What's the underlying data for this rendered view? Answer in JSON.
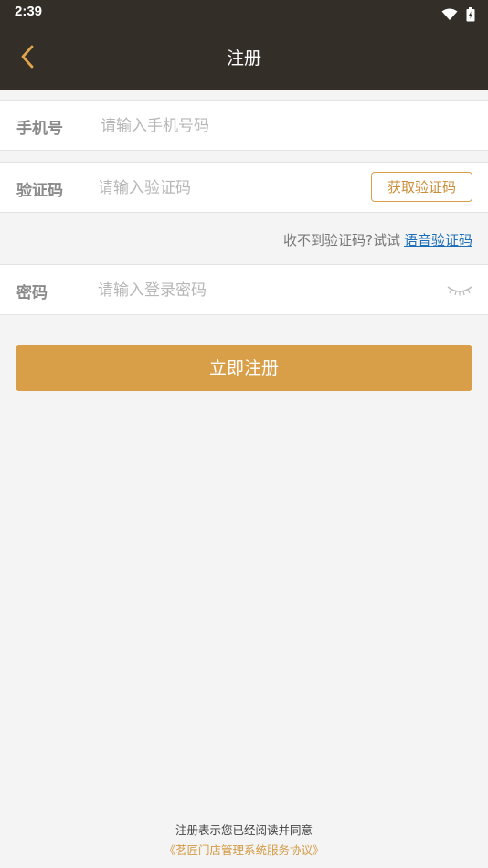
{
  "status_bar": {
    "time": "2:39"
  },
  "header": {
    "title": "注册"
  },
  "form": {
    "phone": {
      "label": "手机号",
      "placeholder": "请输入手机号码",
      "value": ""
    },
    "code": {
      "label": "验证码",
      "placeholder": "请输入验证码",
      "value": "",
      "get_code_label": "获取验证码"
    },
    "voice_hint": {
      "prefix": "收不到验证码?试试",
      "link": "语音验证码"
    },
    "password": {
      "label": "密码",
      "placeholder": "请输入登录密码",
      "value": ""
    },
    "submit_label": "立即注册"
  },
  "footer": {
    "agree_text": "注册表示您已经阅读并同意",
    "agreement_link": "《茗匠门店管理系统服务协议》"
  },
  "colors": {
    "header_bg": "#332f28",
    "accent": "#d89f48",
    "link_blue": "#1c6fb8"
  }
}
